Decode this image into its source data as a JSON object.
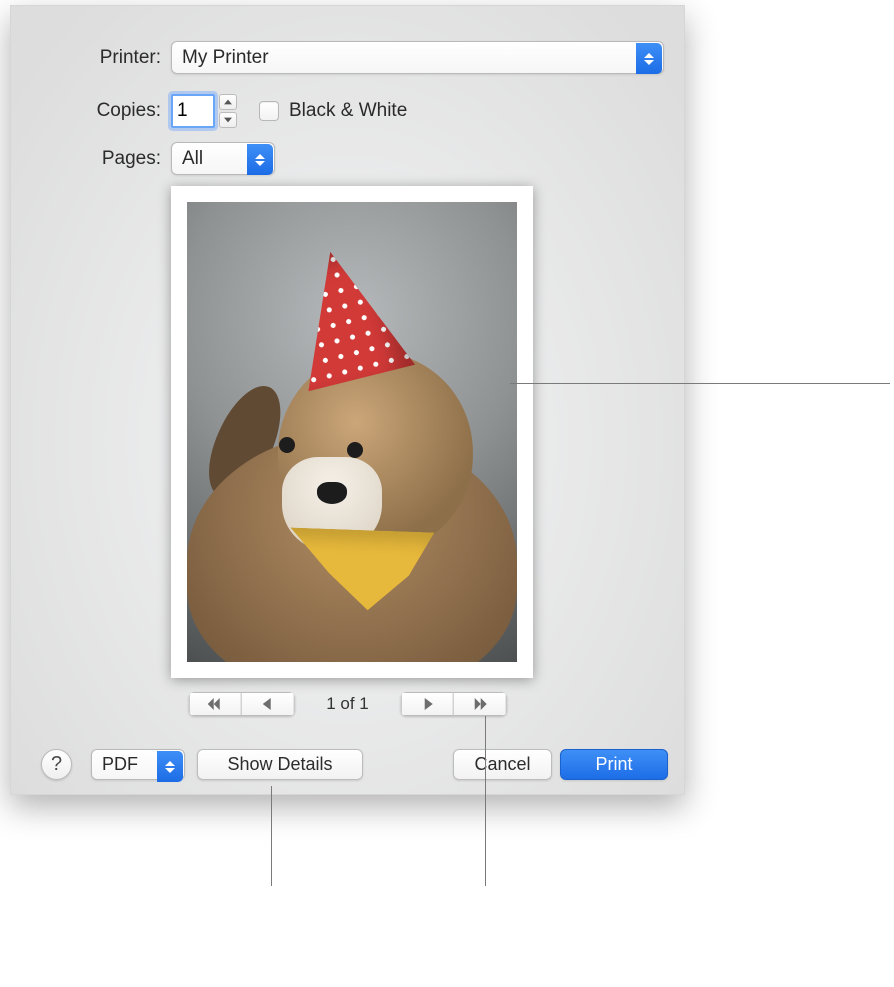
{
  "labels": {
    "printer": "Printer:",
    "copies": "Copies:",
    "pages": "Pages:"
  },
  "printer": {
    "selected": "My Printer"
  },
  "copies": {
    "value": "1",
    "bw_label": "Black & White"
  },
  "pages": {
    "selected": "All"
  },
  "preview": {
    "page_indicator": "1 of 1"
  },
  "buttons": {
    "pdf": "PDF",
    "show_details": "Show Details",
    "cancel": "Cancel",
    "print": "Print",
    "help": "?"
  }
}
